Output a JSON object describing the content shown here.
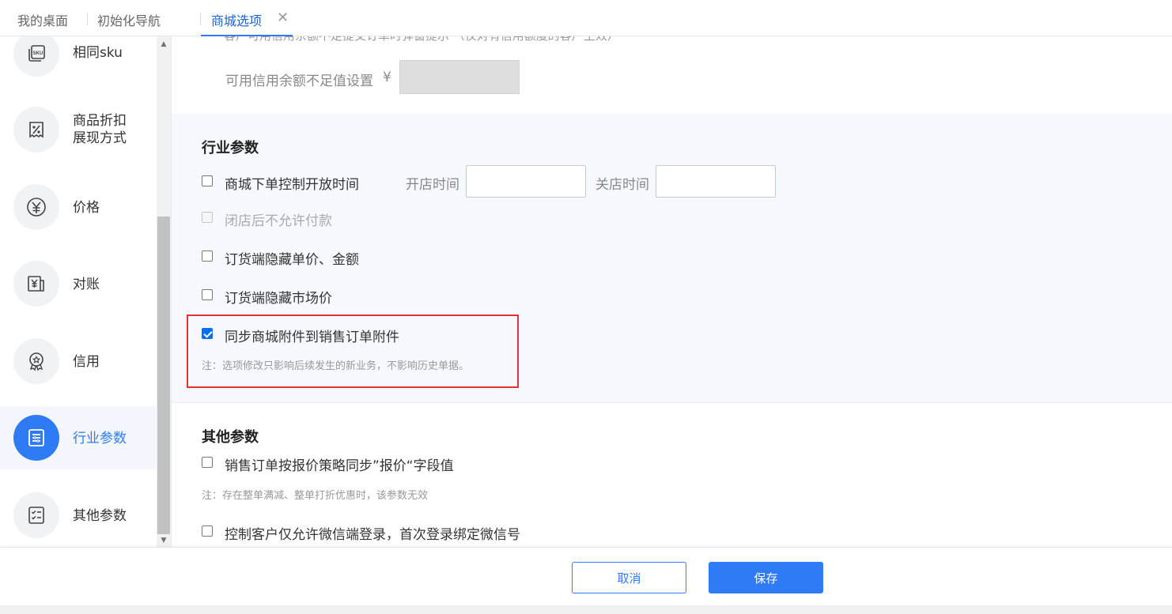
{
  "tabs": [
    {
      "label": "我的桌面"
    },
    {
      "label": "初始化导航"
    },
    {
      "label": "商城选项"
    }
  ],
  "sidebar": {
    "items": [
      {
        "label": "相同sku",
        "icon": "sku-icon"
      },
      {
        "label_line1": "商品折扣",
        "label_line2": "展现方式",
        "icon": "discount-icon"
      },
      {
        "label": "价格",
        "icon": "yen-icon"
      },
      {
        "label": "对账",
        "icon": "reconcile-icon"
      },
      {
        "label": "信用",
        "icon": "badge-icon"
      },
      {
        "label": "行业参数",
        "icon": "list-icon",
        "active": true
      },
      {
        "label": "其他参数",
        "icon": "checklist-icon"
      }
    ]
  },
  "credit": {
    "partial_text": "客户可用信用余额不足提交订单时弹窗提示    （仅对有信用额度的客户生效）",
    "insufficient_label": "可用信用余额不足值设置",
    "currency": "¥"
  },
  "industry": {
    "title": "行业参数",
    "open_time_control": {
      "label": "商城下单控制开放时间",
      "checked": false
    },
    "open_time_label": "开店时间",
    "close_time_label": "关店时间",
    "no_pay_after_close": {
      "label": "闭店后不允许付款",
      "checked": false,
      "disabled": true
    },
    "hide_price_amount": {
      "label": "订货端隐藏单价、金额",
      "checked": false
    },
    "hide_market_price": {
      "label": "订货端隐藏市场价",
      "checked": false
    },
    "sync_attachments": {
      "label": "同步商城附件到销售订单附件",
      "checked": true
    },
    "sync_note": "注：选项修改只影响后续发生的新业务，不影响历史单据。"
  },
  "other": {
    "title": "其他参数",
    "sync_quote": {
      "label": "销售订单按报价策略同步”报价“字段值",
      "checked": false
    },
    "sync_quote_note": "注：存在整单满减、整单打折优惠时，该参数无效",
    "wechat_login": {
      "label": "控制客户仅允许微信端登录，首次登录绑定微信号",
      "checked": false
    }
  },
  "footer": {
    "cancel_label": "取消",
    "save_label": "保存"
  },
  "colors": {
    "accent": "#2f7bf5",
    "highlight": "#e5302e",
    "section_bg": "#f5f8fd"
  }
}
